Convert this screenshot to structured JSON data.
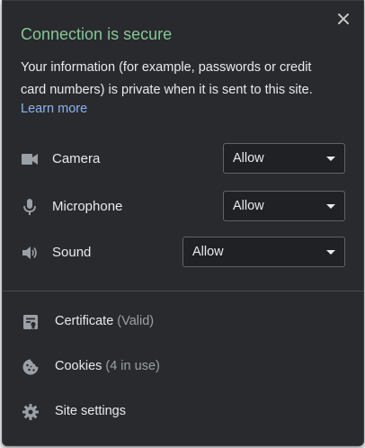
{
  "popup": {
    "title": "Connection is secure",
    "description": "Your information (for example, passwords or credit card numbers) is private when it is sent to this site.",
    "learn_more": "Learn more",
    "close_icon": "close-icon"
  },
  "permissions": [
    {
      "label": "Camera",
      "value": "Allow",
      "icon": "camera-icon"
    },
    {
      "label": "Microphone",
      "value": "Allow",
      "icon": "microphone-icon"
    },
    {
      "label": "Sound",
      "value": "Allow",
      "icon": "speaker-icon"
    }
  ],
  "links": [
    {
      "label": "Certificate",
      "sub": "(Valid)",
      "icon": "certificate-icon"
    },
    {
      "label": "Cookies",
      "sub": "(4 in use)",
      "icon": "cookie-icon"
    },
    {
      "label": "Site settings",
      "sub": "",
      "icon": "gear-icon"
    }
  ],
  "colors": {
    "background": "#292a2d",
    "title": "#81c995",
    "link": "#8ab4f8",
    "text": "#e8eaed",
    "muted": "#9aa0a6"
  }
}
